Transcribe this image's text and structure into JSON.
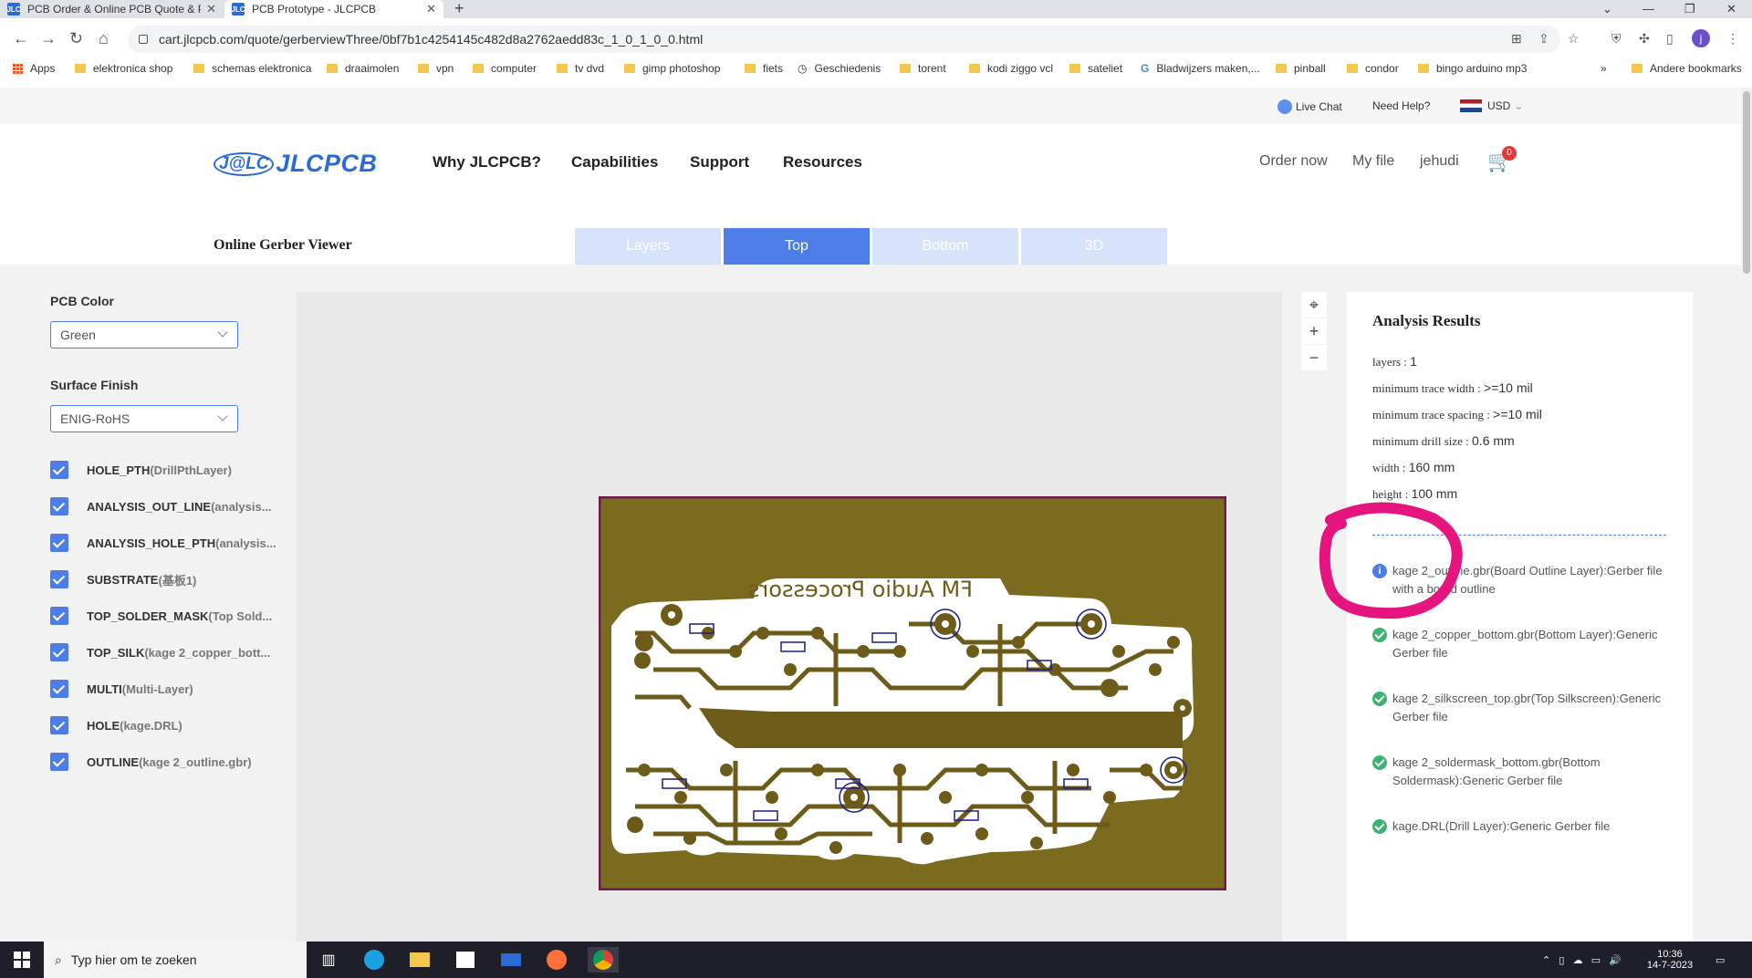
{
  "browser": {
    "tabs": [
      {
        "title": "PCB Order & Online PCB Quote & PCB Prototype - JLCPCB",
        "favicon": "JLC"
      },
      {
        "title": "PCB Prototype - JLCPCB",
        "favicon": "JLC"
      }
    ],
    "url": "cart.jlcpcb.com/quote/gerberviewThree/0bf7b1c4254145c482d8a2762aedd83c_1_0_1_0_0.html",
    "avatar_letter": "j",
    "bookmarks": [
      {
        "label": "Apps",
        "icon": "apps-icon"
      },
      {
        "label": "elektronica shop",
        "icon": "folder-icon"
      },
      {
        "label": "schemas elektronica",
        "icon": "folder-icon"
      },
      {
        "label": "draaimolen",
        "icon": "folder-icon"
      },
      {
        "label": "vpn",
        "icon": "folder-icon"
      },
      {
        "label": "computer",
        "icon": "folder-icon"
      },
      {
        "label": "tv dvd",
        "icon": "folder-icon"
      },
      {
        "label": "gimp photoshop",
        "icon": "folder-icon"
      },
      {
        "label": "fiets",
        "icon": "folder-icon"
      },
      {
        "label": "Geschiedenis",
        "icon": "history-icon"
      },
      {
        "label": "torent",
        "icon": "folder-icon"
      },
      {
        "label": "kodi ziggo vcl",
        "icon": "folder-icon"
      },
      {
        "label": "sateliet",
        "icon": "folder-icon"
      },
      {
        "label": "Bladwijzers maken,...",
        "icon": "google-icon"
      },
      {
        "label": "pinball",
        "icon": "folder-icon"
      },
      {
        "label": "condor",
        "icon": "folder-icon"
      },
      {
        "label": "bingo arduino mp3",
        "icon": "folder-icon"
      }
    ],
    "bookmarks_overflow": "»",
    "other_bookmarks": "Andere bookmarks"
  },
  "site": {
    "topbar": {
      "live_chat": "Live Chat",
      "need_help": "Need Help?",
      "currency": "USD"
    },
    "logo": {
      "mark": "J@LC",
      "word": "JLCPCB"
    },
    "nav": [
      "Why JLCPCB?",
      "Capabilities",
      "Support",
      "Resources"
    ],
    "nav_right": {
      "order_now": "Order now",
      "my_file": "My file",
      "user": "jehudi"
    },
    "cart_count": "0"
  },
  "viewer": {
    "title": "Online Gerber Viewer",
    "tabs": [
      "Layers",
      "Top",
      "Bottom",
      "3D"
    ],
    "active_tab": "Top"
  },
  "left_panel": {
    "pcb_color_label": "PCB Color",
    "pcb_color_value": "Green",
    "surface_finish_label": "Surface Finish",
    "surface_finish_value": "ENIG-RoHS",
    "layers": [
      {
        "name": "HOLE_PTH",
        "sub": "(DrillPthLayer)"
      },
      {
        "name": "ANALYSIS_OUT_LINE",
        "sub": "(analysis..."
      },
      {
        "name": "ANALYSIS_HOLE_PTH",
        "sub": "(analysis..."
      },
      {
        "name": "SUBSTRATE",
        "sub": "(基板1)"
      },
      {
        "name": "TOP_SOLDER_MASK",
        "sub": "(Top Sold..."
      },
      {
        "name": "TOP_SILK",
        "sub": "(kage 2_copper_bott..."
      },
      {
        "name": "MULTI",
        "sub": "(Multi-Layer)"
      },
      {
        "name": "HOLE",
        "sub": "(kage.DRL)"
      },
      {
        "name": "OUTLINE",
        "sub": "(kage 2_outline.gbr)"
      }
    ]
  },
  "pcb": {
    "silk_text": "FM Audio Processors",
    "board_color": "#7a6b1e",
    "copper_color": "#6d5b1a",
    "silk_color": "#1c1c8a",
    "outline_color": "#6a1b4d"
  },
  "analysis": {
    "title": "Analysis Results",
    "stats": [
      {
        "label": "layers : ",
        "value": "1"
      },
      {
        "label": "minimum trace width : ",
        "value": ">=10 mil"
      },
      {
        "label": "minimum trace spacing : ",
        "value": ">=10 mil"
      },
      {
        "label": "minimum drill size : ",
        "value": "0.6 mm"
      },
      {
        "label": "width : ",
        "value": "160 mm"
      },
      {
        "label": "height : ",
        "value": "100 mm"
      }
    ],
    "files": [
      {
        "status": "info",
        "text": "kage 2_outline.gbr(Board Outline Layer):Gerber file with a board outline"
      },
      {
        "status": "ok",
        "text": "kage 2_copper_bottom.gbr(Bottom Layer):Generic Gerber file"
      },
      {
        "status": "ok",
        "text": "kage 2_silkscreen_top.gbr(Top Silkscreen):Generic Gerber file"
      },
      {
        "status": "ok",
        "text": "kage 2_soldermask_bottom.gbr(Bottom Soldermask):Generic Gerber file"
      },
      {
        "status": "ok",
        "text": "kage.DRL(Drill Layer):Generic Gerber file"
      }
    ],
    "highlight_color": "#e6147e"
  },
  "taskbar": {
    "search_placeholder": "Typ hier om te zoeken",
    "time": "10:36",
    "date": "14-7-2023"
  }
}
